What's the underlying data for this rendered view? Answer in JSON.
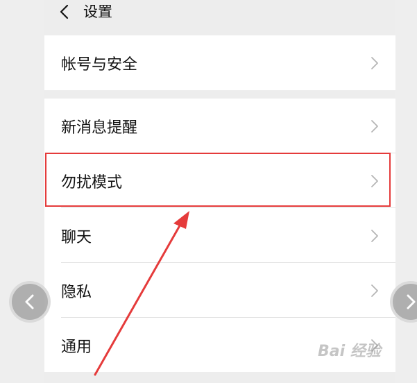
{
  "header": {
    "title": "设置",
    "back_icon": "chevron-left-icon"
  },
  "groups": [
    {
      "items": [
        {
          "label": "帐号与安全"
        }
      ]
    },
    {
      "items": [
        {
          "label": "新消息提醒"
        },
        {
          "label": "勿扰模式",
          "highlighted": true
        },
        {
          "label": "聊天"
        },
        {
          "label": "隐私"
        },
        {
          "label": "通用"
        }
      ]
    }
  ],
  "annotation": {
    "highlight_color": "#e53b3b",
    "arrow_color": "#e53b3b"
  },
  "carousel": {
    "prev_icon": "chevron-left-icon",
    "next_icon": "chevron-right-icon"
  },
  "watermark": {
    "text": "Bai 经验",
    "logo": "baidu-paw-icon"
  }
}
